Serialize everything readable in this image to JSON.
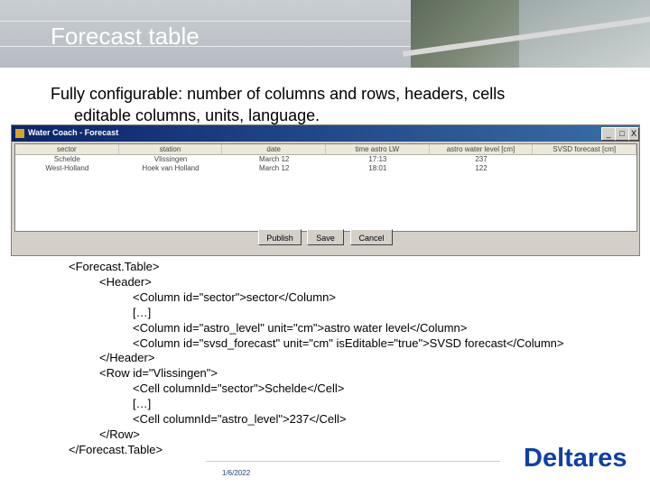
{
  "slide": {
    "title": "Forecast table",
    "subtitle_line1": "Fully configurable: number of columns and rows, headers, cells",
    "subtitle_line2": "editable columns, units, language.",
    "date": "1/6/2022",
    "logo": "Deltares"
  },
  "window": {
    "title": "Water Coach - Forecast",
    "minimize_label": "_",
    "maximize_label": "□",
    "close_label": "X",
    "columns": [
      "sector",
      "station",
      "date",
      "time astro LW",
      "astro water level [cm]",
      "SVSD forecast [cm]"
    ],
    "rows": [
      [
        "Schelde",
        "Vlissingen",
        "March 12",
        "17:13",
        "237",
        ""
      ],
      [
        "West-Holland",
        "Hoek van Holland",
        "March 12",
        "18:01",
        "122",
        ""
      ]
    ],
    "buttons": {
      "publish": "Publish",
      "save": "Save",
      "cancel": "Cancel"
    }
  },
  "code": {
    "l1": "<Forecast.Table>",
    "l2": "<Header>",
    "l3": "<Column id=\"sector\">sector</Column>",
    "l4": "[…]",
    "l5": "<Column id=\"astro_level\" unit=\"cm\">astro water level</Column>",
    "l6": "<Column id=\"svsd_forecast\" unit=\"cm\" isEditable=\"true\">SVSD forecast</Column>",
    "l7": "</Header>",
    "l8": "<Row id=\"Vlissingen\">",
    "l9": "<Cell columnId=\"sector\">Schelde</Cell>",
    "l10": "[…]",
    "l11": "<Cell columnId=\"astro_level\">237</Cell>",
    "l12": "</Row>",
    "l13": "</Forecast.Table>"
  }
}
